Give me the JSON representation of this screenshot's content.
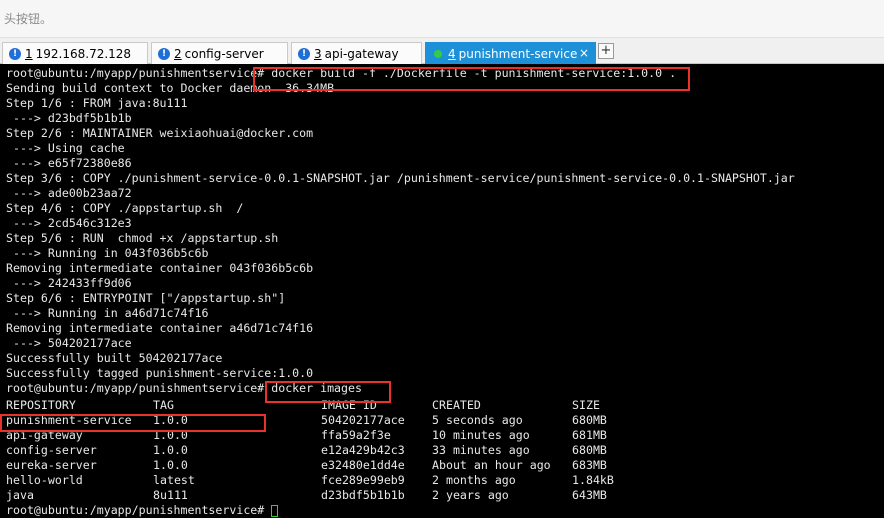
{
  "hint_text": "头按钮。",
  "tabs": [
    {
      "num": "1",
      "label": " 192.168.72.128",
      "status_icon": "warning-icon"
    },
    {
      "num": "2",
      "label": " config-server",
      "status_icon": "warning-icon"
    },
    {
      "num": "3",
      "label": " api-gateway",
      "status_icon": "warning-icon"
    },
    {
      "num": "4",
      "label": " punishment-service",
      "status_icon": "connected-dot-icon",
      "close": "×"
    }
  ],
  "add_tab_label": "+",
  "terminal_lines": [
    "root@ubuntu:/myapp/punishmentservice# docker build -f ./Dockerfile -t punishment-service:1.0.0 .",
    "Sending build context to Docker daemon  36.34MB",
    "Step 1/6 : FROM java:8u111",
    " ---> d23bdf5b1b1b",
    "Step 2/6 : MAINTAINER weixiaohuai@docker.com",
    " ---> Using cache",
    " ---> e65f72380e86",
    "Step 3/6 : COPY ./punishment-service-0.0.1-SNAPSHOT.jar /punishment-service/punishment-service-0.0.1-SNAPSHOT.jar",
    " ---> ade00b23aa72",
    "Step 4/6 : COPY ./appstartup.sh  /",
    " ---> 2cd546c312e3",
    "Step 5/6 : RUN  chmod +x /appstartup.sh",
    " ---> Running in 043f036b5c6b",
    "Removing intermediate container 043f036b5c6b",
    " ---> 242433ff9d06",
    "Step 6/6 : ENTRYPOINT [\"/appstartup.sh\"]",
    " ---> Running in a46d71c74f16",
    "Removing intermediate container a46d71c74f16",
    " ---> 504202177ace",
    "Successfully built 504202177ace",
    "Successfully tagged punishment-service:1.0.0",
    "root@ubuntu:/myapp/punishmentservice# docker images"
  ],
  "images_table": {
    "headers": [
      "REPOSITORY",
      "TAG",
      "IMAGE ID",
      "CREATED",
      "SIZE"
    ],
    "rows": [
      [
        "punishment-service",
        "1.0.0",
        "504202177ace",
        "5 seconds ago",
        "680MB"
      ],
      [
        "api-gateway",
        "1.0.0",
        "ffa59a2f3e",
        "10 minutes ago",
        "681MB"
      ],
      [
        "config-server",
        "1.0.0",
        "e12a429b42c3",
        "33 minutes ago",
        "680MB"
      ],
      [
        "eureka-server",
        "1.0.0",
        "e32480e1dd4e",
        "About an hour ago",
        "683MB"
      ],
      [
        "hello-world",
        "latest",
        "fce289e99eb9",
        "2 months ago",
        "1.84kB"
      ],
      [
        "java",
        "8u111",
        "d23bdf5b1b1b",
        "2 years ago",
        "643MB"
      ]
    ]
  },
  "final_prompt": "root@ubuntu:/myapp/punishmentservice# ",
  "colors": {
    "highlight_box": "#e8322b",
    "active_tab": "#1e90d8",
    "cursor": "#2fd12f"
  }
}
